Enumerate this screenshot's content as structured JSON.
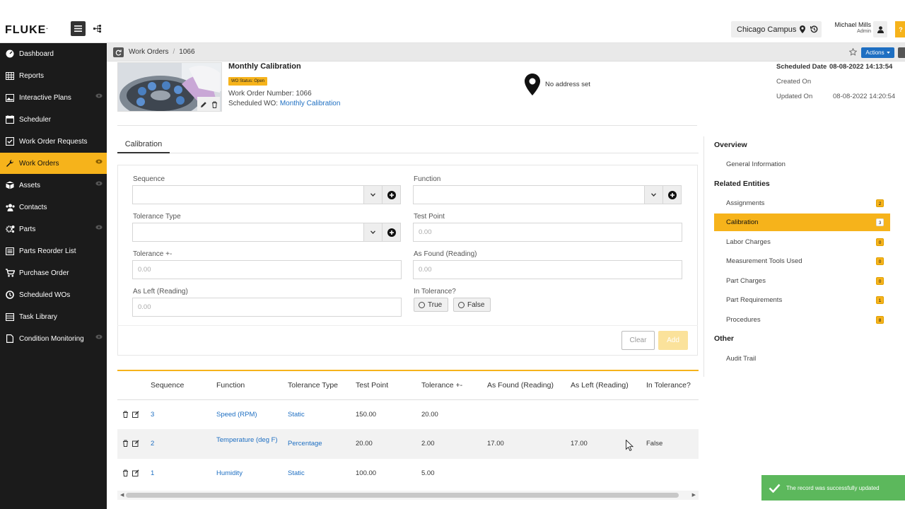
{
  "brand": {
    "logo_text": "FLUKE",
    "logo_mark": "."
  },
  "topbar": {
    "campus": "Chicago Campus",
    "user_name": "Michael Mills",
    "user_role": "Admin",
    "help_label": "?"
  },
  "sidebar": {
    "items": [
      {
        "label": "Dashboard",
        "icon": "dashboard-icon"
      },
      {
        "label": "Reports",
        "icon": "reports-icon"
      },
      {
        "label": "Interactive Plans",
        "icon": "plans-icon"
      },
      {
        "label": "Scheduler",
        "icon": "calendar-icon"
      },
      {
        "label": "Work Order Requests",
        "icon": "requests-icon"
      },
      {
        "label": "Work Orders",
        "icon": "wrench-icon"
      },
      {
        "label": "Assets",
        "icon": "cube-icon"
      },
      {
        "label": "Contacts",
        "icon": "contacts-icon"
      },
      {
        "label": "Parts",
        "icon": "gears-icon"
      },
      {
        "label": "Parts Reorder List",
        "icon": "list-icon"
      },
      {
        "label": "Purchase Order",
        "icon": "cart-icon"
      },
      {
        "label": "Scheduled WOs",
        "icon": "clock-icon"
      },
      {
        "label": "Task Library",
        "icon": "library-icon"
      },
      {
        "label": "Condition Monitoring",
        "icon": "document-icon"
      }
    ],
    "active_index": 5
  },
  "breadcrumb": {
    "items": [
      "Work Orders",
      "1066"
    ],
    "actions_label": "Actions"
  },
  "work_order": {
    "title": "Monthly Calibration",
    "status": "WO Status: Open",
    "number_label": "Work Order Number:",
    "number": "1066",
    "scheduled_label": "Scheduled WO:",
    "scheduled_link": "Monthly Calibration",
    "address": "No address set",
    "scheduled_date_label": "Scheduled Date",
    "scheduled_date": "08-08-2022 14:13:54",
    "created_label": "Created On",
    "created_value": "",
    "updated_label": "Updated On",
    "updated_value": "08-08-2022 14:20:54"
  },
  "tab": {
    "label": "Calibration"
  },
  "form": {
    "sequence_label": "Sequence",
    "function_label": "Function",
    "tolerance_type_label": "Tolerance Type",
    "test_point_label": "Test Point",
    "test_point_placeholder": "0.00",
    "tolerance_label": "Tolerance +-",
    "tolerance_placeholder": "0.00",
    "as_found_label": "As Found (Reading)",
    "as_found_placeholder": "0.00",
    "as_left_label": "As Left (Reading)",
    "as_left_placeholder": "0.00",
    "in_tolerance_label": "In Tolerance?",
    "true_label": "True",
    "false_label": "False",
    "clear_label": "Clear",
    "add_label": "Add"
  },
  "table": {
    "columns": [
      "Sequence",
      "Function",
      "Tolerance Type",
      "Test Point",
      "Tolerance +-",
      "As Found (Reading)",
      "As Left (Reading)",
      "In Tolerance?"
    ],
    "rows": [
      {
        "sequence": "3",
        "function": "Speed (RPM)",
        "tolerance_type": "Static",
        "test_point": "150.00",
        "tolerance": "20.00",
        "as_found": "",
        "as_left": "",
        "in_tolerance": ""
      },
      {
        "sequence": "2",
        "function": "Temperature (deg F)",
        "tolerance_type": "Percentage",
        "test_point": "20.00",
        "tolerance": "2.00",
        "as_found": "17.00",
        "as_left": "17.00",
        "in_tolerance": "False"
      },
      {
        "sequence": "1",
        "function": "Humidity",
        "tolerance_type": "Static",
        "test_point": "100.00",
        "tolerance": "5.00",
        "as_found": "",
        "as_left": "",
        "in_tolerance": ""
      }
    ]
  },
  "right_panel": {
    "overview_heading": "Overview",
    "general_info": "General Information",
    "related_heading": "Related Entities",
    "related": [
      {
        "label": "Assignments",
        "count": "2"
      },
      {
        "label": "Calibration",
        "count": "3"
      },
      {
        "label": "Labor Charges",
        "count": "0"
      },
      {
        "label": "Measurement Tools Used",
        "count": "0"
      },
      {
        "label": "Part Charges",
        "count": "0"
      },
      {
        "label": "Part Requirements",
        "count": "1"
      },
      {
        "label": "Procedures",
        "count": "8"
      }
    ],
    "active_index": 1,
    "other_heading": "Other",
    "audit_trail": "Audit Trail"
  },
  "toast": {
    "message": "The record was successfully updated"
  },
  "colors": {
    "accent": "#f6b31b",
    "link": "#1e6fc2",
    "sidebar_bg": "#1b1b1b",
    "success": "#5cb85c"
  }
}
